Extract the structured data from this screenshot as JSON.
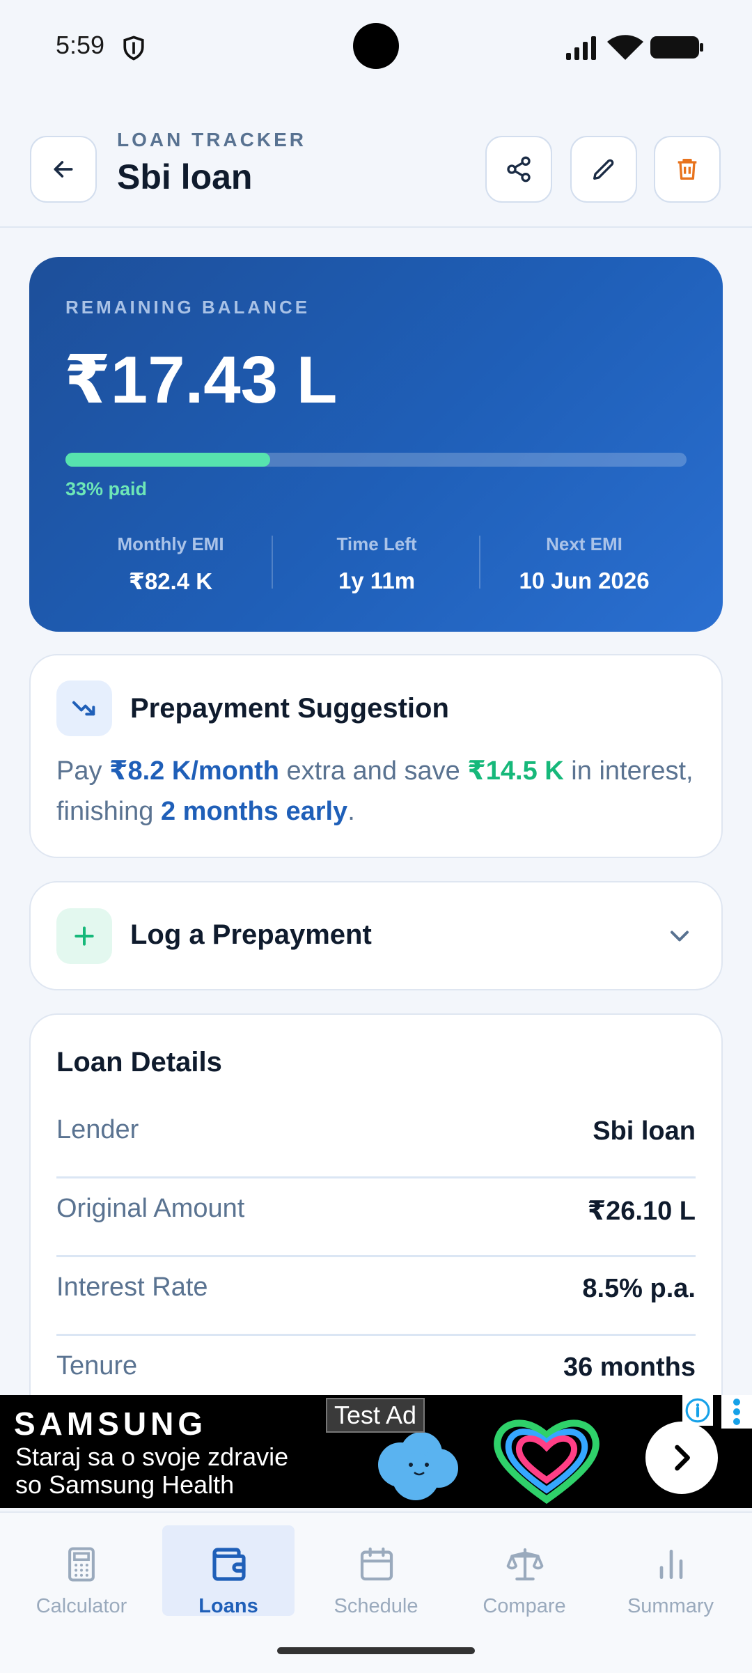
{
  "status_bar": {
    "time": "5:59"
  },
  "header": {
    "subtitle": "LOAN TRACKER",
    "title": "Sbi loan"
  },
  "balance_card": {
    "label": "REMAINING BALANCE",
    "amount": "₹17.43 L",
    "paid_fraction": 0.33,
    "paid_text": "33% paid",
    "stats": [
      {
        "label": "Monthly EMI",
        "value": "₹82.4 K"
      },
      {
        "label": "Time Left",
        "value": "1y 11m"
      },
      {
        "label": "Next EMI",
        "value": "10 Jun 2026"
      }
    ]
  },
  "suggestion": {
    "title": "Prepayment Suggestion",
    "text_pay": "Pay ",
    "amount": "₹8.2 K/month",
    "text_mid": " extra and save ",
    "saving": "₹14.5 K",
    "text_after": " in interest, finishing ",
    "early": "2 months early",
    "text_end": "."
  },
  "log_prepayment": {
    "title": "Log a Prepayment"
  },
  "loan_details": {
    "title": "Loan Details",
    "rows": [
      {
        "key": "Lender",
        "value": "Sbi loan"
      },
      {
        "key": "Original Amount",
        "value": "₹26.10 L"
      },
      {
        "key": "Interest Rate",
        "value": "8.5% p.a."
      },
      {
        "key": "Tenure",
        "value": "36 months"
      }
    ]
  },
  "ad": {
    "brand": "SAMSUNG",
    "line1": "Staraj sa o svoje zdravie",
    "line2": "so Samsung Health",
    "tag": "Test Ad"
  },
  "nav": {
    "items": [
      {
        "label": "Calculator",
        "icon": "calculator-icon"
      },
      {
        "label": "Loans",
        "icon": "wallet-icon"
      },
      {
        "label": "Schedule",
        "icon": "calendar-icon"
      },
      {
        "label": "Compare",
        "icon": "scale-icon"
      },
      {
        "label": "Summary",
        "icon": "bar-chart-icon"
      }
    ],
    "active": "Loans"
  },
  "colors": {
    "accent": "#1f5fb8",
    "progress": "#57e3ae",
    "success": "#16b87a",
    "danger": "#e8731d"
  }
}
